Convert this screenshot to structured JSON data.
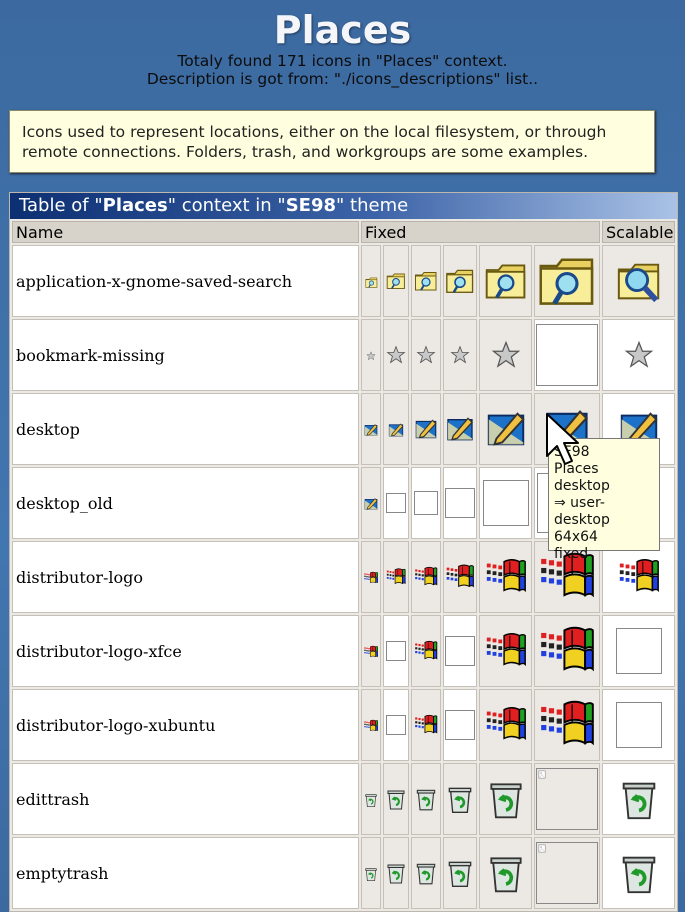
{
  "header": {
    "title": "Places",
    "line1": "Totaly found 171 icons in \"Places\" context.",
    "line2": "Description is got from: \"./icons_descriptions\" list.."
  },
  "description": "Icons used to represent locations, either on the local filesystem, or through remote connections. Folders, trash, and workgroups are some examples.",
  "caption": {
    "prefix": "Table of \"",
    "context": "Places",
    "middle": "\" context in \"",
    "theme": "SE98",
    "suffix": "\" theme"
  },
  "columns": {
    "name": "Name",
    "fixed": "Fixed",
    "scalable": "Scalable"
  },
  "rows": [
    {
      "name": "application-x-gnome-saved-search"
    },
    {
      "name": "bookmark-missing"
    },
    {
      "name": "desktop"
    },
    {
      "name": "desktop_old"
    },
    {
      "name": "distributor-logo"
    },
    {
      "name": "distributor-logo-xfce"
    },
    {
      "name": "distributor-logo-xubuntu"
    },
    {
      "name": "edittrash"
    },
    {
      "name": "emptytrash"
    }
  ],
  "tooltip": {
    "line1": "SE98",
    "line2": "Places",
    "line3": "desktop",
    "line4": "⇒ user-desktop",
    "line5": "64x64",
    "line6": "fixed"
  },
  "icons": [
    "folder-search-icon",
    "star-icon",
    "desktop-pen-icon",
    "windows-flag-icon",
    "recycle-bin-icon",
    "broken-image-icon",
    "mouse-pointer-icon"
  ],
  "colors": {
    "background": "#3e6fa6",
    "caption_start": "#0c2f72",
    "tooltip_bg": "#ffffe0"
  }
}
